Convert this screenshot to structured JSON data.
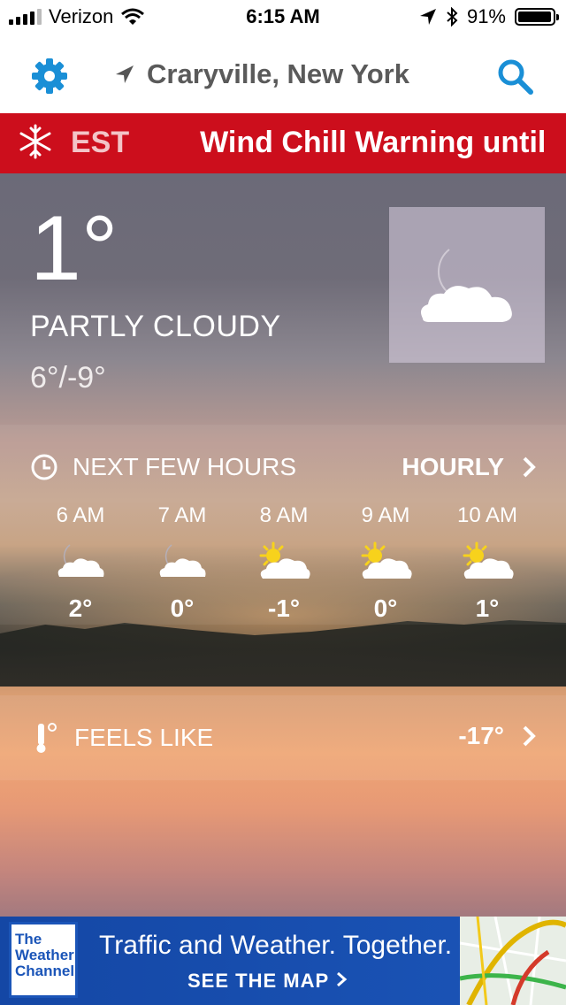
{
  "status_bar": {
    "carrier": "Verizon",
    "time": "6:15 AM",
    "battery": "91%",
    "battery_level": 0.91
  },
  "header": {
    "location": "Craryville, New York"
  },
  "alert": {
    "ticker_text": "EST",
    "ticker_text2": "Wind Chill Warning until"
  },
  "current": {
    "temperature": "1°",
    "condition": "PARTLY CLOUDY",
    "hi_lo": "6°/-9°",
    "icon": "night-partly-cloudy-icon"
  },
  "next_hours": {
    "label": "NEXT FEW HOURS",
    "hourly_label": "HOURLY",
    "hours": [
      {
        "time": "6 AM",
        "temp": "2°",
        "icon": "moon-cloud-icon"
      },
      {
        "time": "7 AM",
        "temp": "0°",
        "icon": "moon-cloud-icon"
      },
      {
        "time": "8 AM",
        "temp": "-1°",
        "icon": "sun-cloud-icon"
      },
      {
        "time": "9 AM",
        "temp": "0°",
        "icon": "sun-cloud-icon"
      },
      {
        "time": "10 AM",
        "temp": "1°",
        "icon": "sun-cloud-icon"
      }
    ]
  },
  "feels_like": {
    "label": "FEELS LIKE",
    "value": "-17°"
  },
  "ad": {
    "brand": "The Weather Channel",
    "headline": "Traffic and Weather. Together.",
    "cta": "SEE THE MAP"
  },
  "colors": {
    "accent": "#1a8fd6",
    "alert": "#cc0e1c",
    "ad": "#1b55b8"
  }
}
